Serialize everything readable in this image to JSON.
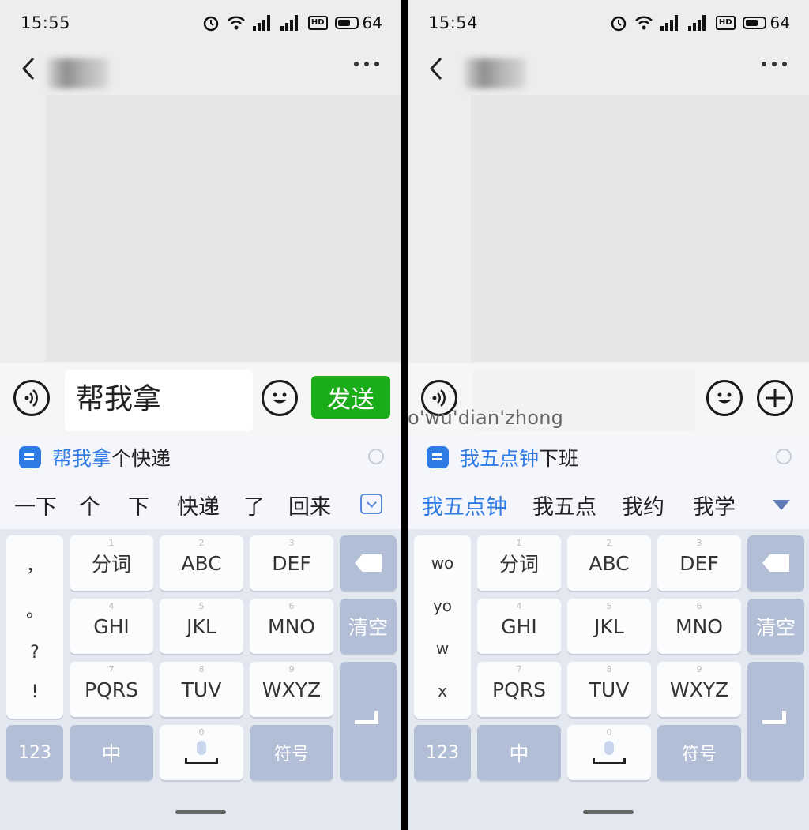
{
  "left": {
    "status": {
      "time": "15:55",
      "battery": "64"
    },
    "input_text": "帮我拿",
    "send_label": "发送",
    "ai_suggestion": {
      "highlight": "帮我拿",
      "rest": "个快递"
    },
    "candidates": [
      "一下",
      "个",
      "下",
      "快递",
      "了",
      "回来"
    ],
    "side_keys": [
      "，",
      "。",
      "?",
      "!"
    ]
  },
  "right": {
    "status": {
      "time": "15:54",
      "battery": "64"
    },
    "pinyin": "o'wu'dian'zhong",
    "ai_suggestion": {
      "highlight": "我五点钟",
      "rest": "下班"
    },
    "candidates": [
      "我五点钟",
      "我五点",
      "我约",
      "我学"
    ],
    "side_keys": [
      "wo",
      "yo",
      "w",
      "x"
    ]
  },
  "keyboard": {
    "keys": [
      {
        "num": "1",
        "label": "分词"
      },
      {
        "num": "2",
        "label": "ABC"
      },
      {
        "num": "3",
        "label": "DEF"
      },
      {
        "num": "4",
        "label": "GHI"
      },
      {
        "num": "5",
        "label": "JKL"
      },
      {
        "num": "6",
        "label": "MNO"
      },
      {
        "num": "7",
        "label": "PQRS"
      },
      {
        "num": "8",
        "label": "TUV"
      },
      {
        "num": "9",
        "label": "WXYZ"
      }
    ],
    "clear_label": "清空",
    "num_label": "123",
    "lang_label": "中",
    "space_num": "0",
    "symbol_label": "符号"
  },
  "colors": {
    "send_green": "#1aad19",
    "accent_blue": "#2f7be6",
    "function_key": "#b1bed6"
  }
}
